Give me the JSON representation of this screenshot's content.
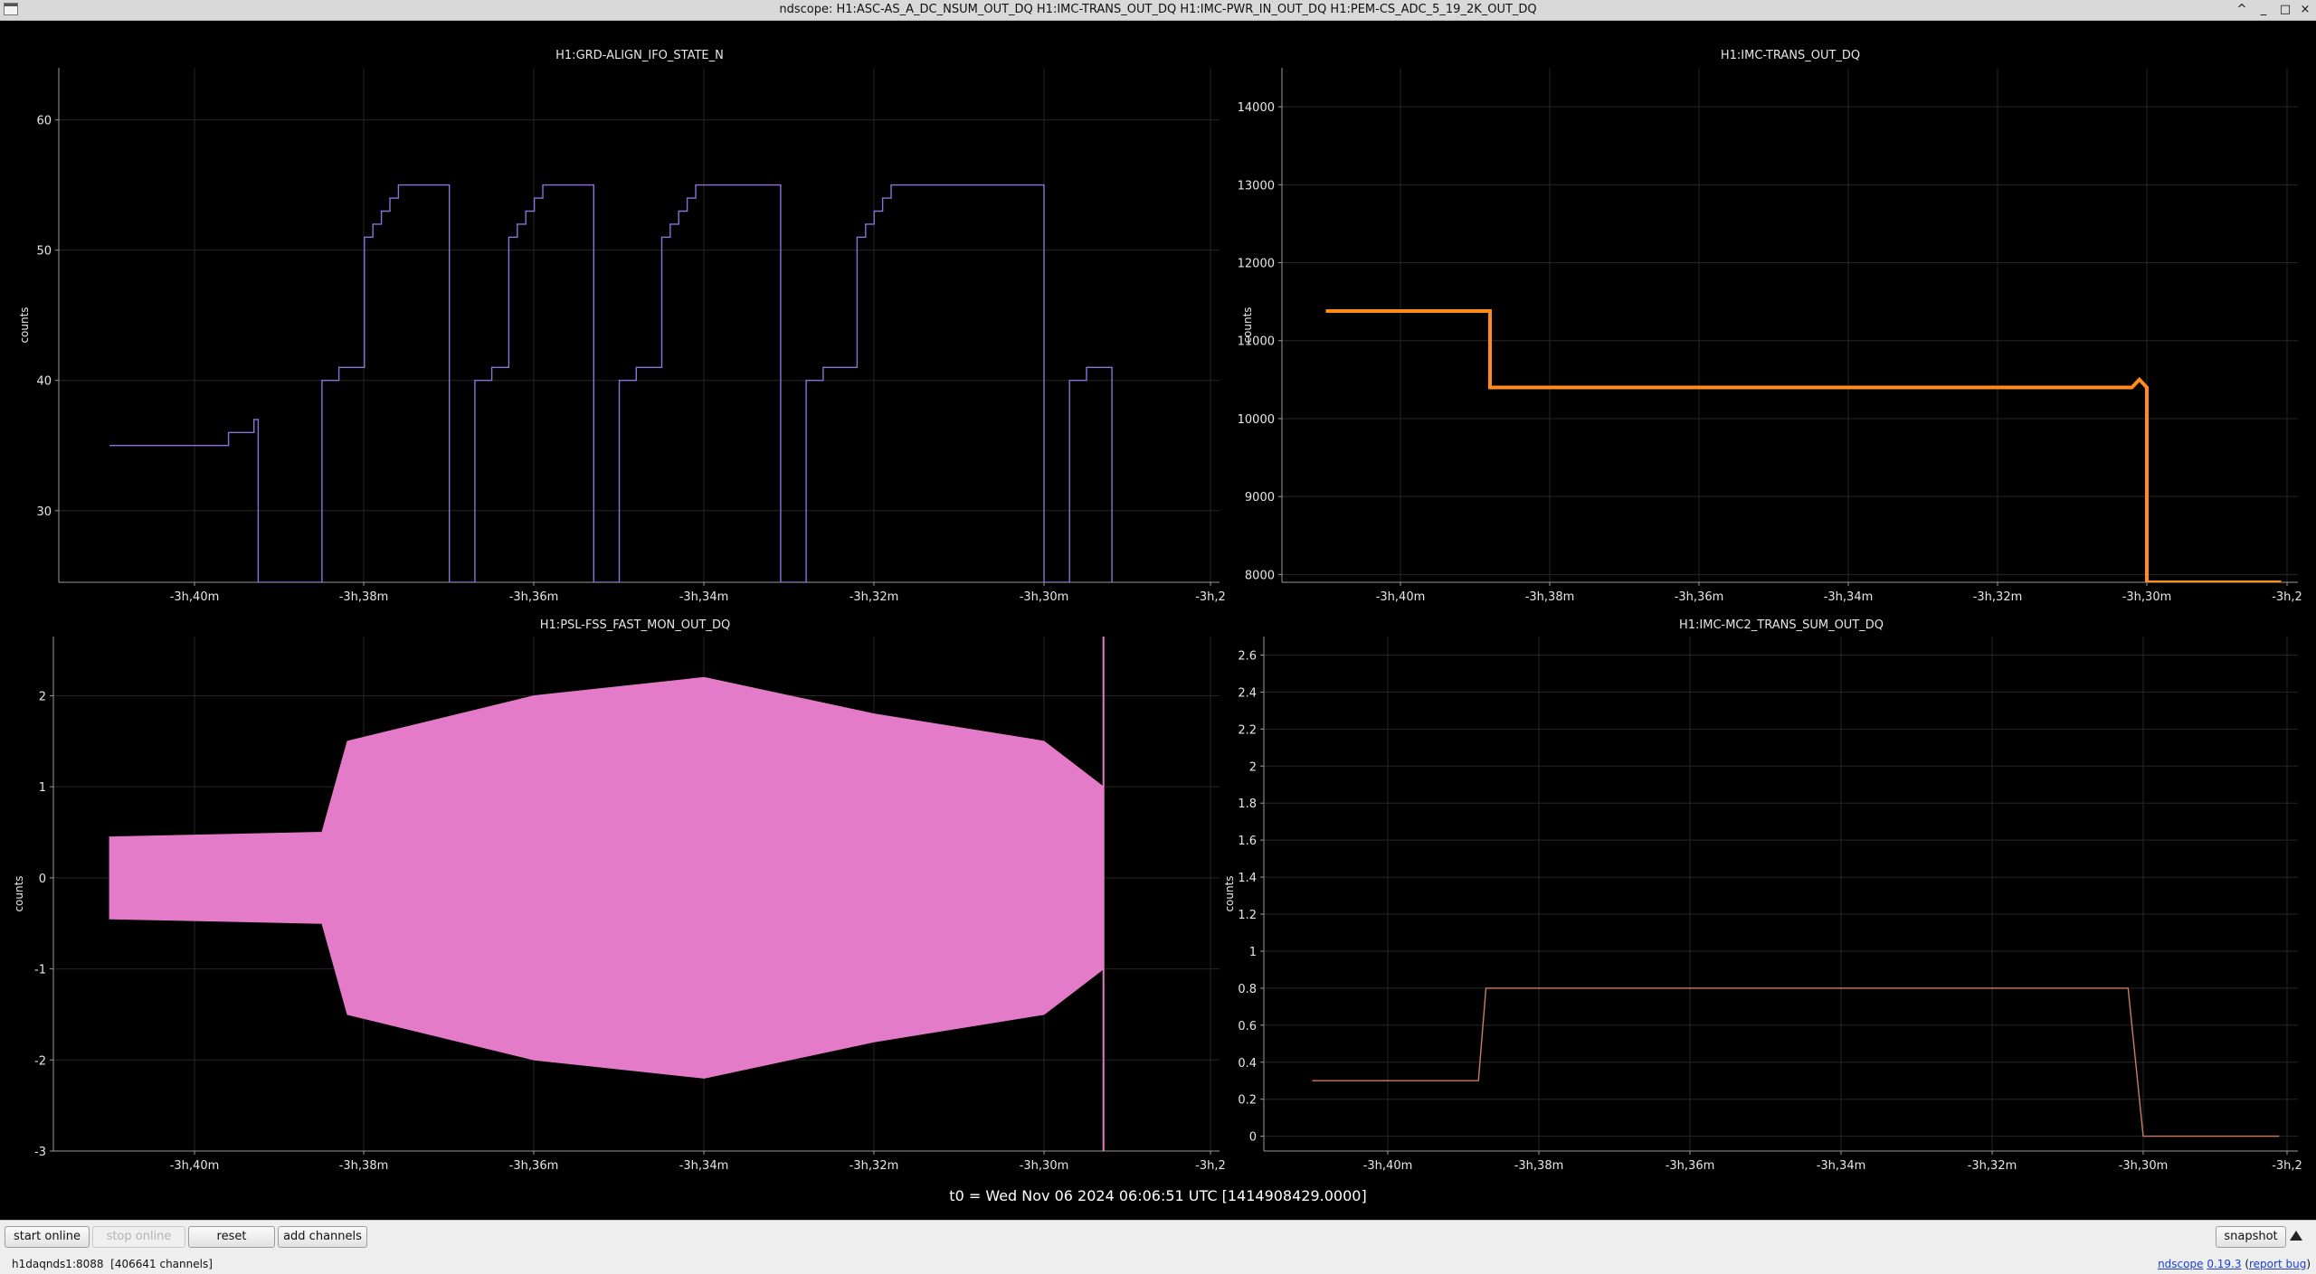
{
  "window": {
    "title": "ndscope: H1:ASC-AS_A_DC_NSUM_OUT_DQ H1:IMC-TRANS_OUT_DQ H1:IMC-PWR_IN_OUT_DQ H1:PEM-CS_ADC_5_19_2K_OUT_DQ",
    "controls": [
      "^",
      "_",
      "□",
      "×"
    ],
    "icons": [
      "chevron-up-icon",
      "minimize-icon",
      "maximize-icon",
      "close-icon"
    ]
  },
  "t0_label": "t0 = Wed Nov 06 2024 06:06:51 UTC [1414908429.0000]",
  "toolbar": {
    "start_online": "start online",
    "stop_online": "stop online",
    "reset": "reset",
    "add_channels": "add channels",
    "snapshot": "snapshot",
    "menu_icon": "triangle-up-icon"
  },
  "status": {
    "server": "h1daqnds1:8088",
    "channels": "[406641 channels]",
    "version_app": "ndscope",
    "version_num": "0.19.3",
    "report_bug": "report bug"
  },
  "chart_data": [
    {
      "type": "line",
      "title": "H1:GRD-ALIGN_IFO_STATE_N",
      "ylabel": "counts",
      "color": "#8a72d8",
      "grid": true,
      "x_unit": "time offset from t0",
      "xlim": [
        "-3h,41m",
        "-3h,28m"
      ],
      "x_ticks": [
        "-3h,40m",
        "-3h,38m",
        "-3h,36m",
        "-3h,34m",
        "-3h,32m",
        "-3h,30m",
        "-3h,2"
      ],
      "ylim": [
        24.5,
        64
      ],
      "y_ticks": [
        "30",
        "40",
        "50",
        "60"
      ],
      "y_tick_values": [
        30,
        40,
        50,
        60
      ],
      "series": [
        {
          "points": [
            [
              -41,
              35
            ],
            [
              -39.6,
              35
            ],
            [
              -39.6,
              36
            ],
            [
              -39.3,
              36
            ],
            [
              -39.3,
              37
            ],
            [
              -39.25,
              37
            ],
            [
              -39.25,
              24.5
            ],
            [
              -38.5,
              24.5
            ],
            [
              -38.5,
              40
            ],
            [
              -38.3,
              40
            ],
            [
              -38.3,
              41
            ],
            [
              -38,
              41
            ],
            [
              -38,
              51
            ],
            [
              -37.9,
              51
            ],
            [
              -37.9,
              52
            ],
            [
              -37.8,
              52
            ],
            [
              -37.8,
              53
            ],
            [
              -37.7,
              53
            ],
            [
              -37.7,
              54
            ],
            [
              -37.6,
              54
            ],
            [
              -37.6,
              55
            ],
            [
              -37.0,
              55
            ],
            [
              -37.0,
              24.5
            ],
            [
              -36.7,
              24.5
            ],
            [
              -36.7,
              40
            ],
            [
              -36.5,
              40
            ],
            [
              -36.5,
              41
            ],
            [
              -36.3,
              41
            ],
            [
              -36.3,
              51
            ],
            [
              -36.2,
              51
            ],
            [
              -36.2,
              52
            ],
            [
              -36.1,
              52
            ],
            [
              -36.1,
              53
            ],
            [
              -36.0,
              53
            ],
            [
              -36.0,
              54
            ],
            [
              -35.9,
              54
            ],
            [
              -35.9,
              55
            ],
            [
              -35.3,
              55
            ],
            [
              -35.3,
              24.5
            ],
            [
              -35.0,
              24.5
            ],
            [
              -35.0,
              40
            ],
            [
              -34.8,
              40
            ],
            [
              -34.8,
              41
            ],
            [
              -34.5,
              41
            ],
            [
              -34.5,
              51
            ],
            [
              -34.4,
              51
            ],
            [
              -34.4,
              52
            ],
            [
              -34.3,
              52
            ],
            [
              -34.3,
              53
            ],
            [
              -34.2,
              53
            ],
            [
              -34.2,
              54
            ],
            [
              -34.1,
              54
            ],
            [
              -34.1,
              55
            ],
            [
              -33.1,
              55
            ],
            [
              -33.1,
              24.5
            ],
            [
              -32.8,
              24.5
            ],
            [
              -32.8,
              40
            ],
            [
              -32.6,
              40
            ],
            [
              -32.6,
              41
            ],
            [
              -32.2,
              41
            ],
            [
              -32.2,
              51
            ],
            [
              -32.1,
              51
            ],
            [
              -32.1,
              52
            ],
            [
              -32.0,
              52
            ],
            [
              -32.0,
              53
            ],
            [
              -31.9,
              53
            ],
            [
              -31.9,
              54
            ],
            [
              -31.8,
              54
            ],
            [
              -31.8,
              55
            ],
            [
              -30.0,
              55
            ],
            [
              -30.0,
              24.5
            ],
            [
              -29.7,
              24.5
            ],
            [
              -29.7,
              40
            ],
            [
              -29.5,
              40
            ],
            [
              -29.5,
              41
            ],
            [
              -29.2,
              41
            ],
            [
              -29.2,
              24.5
            ]
          ]
        }
      ]
    },
    {
      "type": "line",
      "title": "H1:IMC-TRANS_OUT_DQ",
      "ylabel": "counts",
      "color": "#ff8c1a",
      "grid": true,
      "x_unit": "time offset from t0",
      "xlim": [
        "-3h,41m",
        "-3h,28m"
      ],
      "x_ticks": [
        "-3h,40m",
        "-3h,38m",
        "-3h,36m",
        "-3h,34m",
        "-3h,32m",
        "-3h,30m",
        "-3h,2"
      ],
      "ylim": [
        7900,
        14500
      ],
      "y_ticks": [
        "8000",
        "9000",
        "10000",
        "11000",
        "12000",
        "13000",
        "14000"
      ],
      "y_tick_values": [
        8000,
        9000,
        10000,
        11000,
        12000,
        13000,
        14000
      ],
      "series": [
        {
          "points": [
            [
              -41,
              11380
            ],
            [
              -38.8,
              11380
            ],
            [
              -38.8,
              10400
            ],
            [
              -30.2,
              10400
            ],
            [
              -30.1,
              10500
            ],
            [
              -30.0,
              10400
            ],
            [
              -30.0,
              7900
            ],
            [
              -28.2,
              7900
            ]
          ]
        }
      ]
    },
    {
      "type": "line",
      "title": "H1:PSL-FSS_FAST_MON_OUT_DQ",
      "ylabel": "counts",
      "color": "#e47bc8",
      "grid": true,
      "x_unit": "time offset from t0",
      "xlim": [
        "-3h,41m",
        "-3h,28m"
      ],
      "x_ticks": [
        "-3h,40m",
        "-3h,38m",
        "-3h,36m",
        "-3h,34m",
        "-3h,32m",
        "-3h,30m",
        "-3h,2"
      ],
      "ylim": [
        -3,
        2.65
      ],
      "y_ticks": [
        "-3",
        "-2",
        "-1",
        "0",
        "1",
        "2"
      ],
      "y_tick_values": [
        -3,
        -2,
        -1,
        0,
        1,
        2
      ],
      "series": [
        {
          "envelope": [
            {
              "x": -41,
              "max": 0.45,
              "min": -0.45
            },
            {
              "x": -38.5,
              "max": 0.5,
              "min": -0.5
            },
            {
              "x": -38.2,
              "max": 1.5,
              "min": -1.5
            },
            {
              "x": -36,
              "max": 2,
              "min": -2
            },
            {
              "x": -34,
              "max": 2.2,
              "min": -2.2
            },
            {
              "x": -32,
              "max": 1.8,
              "min": -1.8
            },
            {
              "x": -30,
              "max": 1.5,
              "min": -1.5
            },
            {
              "x": -29.3,
              "max": 1.0,
              "min": -1.0
            }
          ]
        }
      ]
    },
    {
      "type": "line",
      "title": "H1:IMC-MC2_TRANS_SUM_OUT_DQ",
      "ylabel": "counts",
      "color": "#c97e62",
      "grid": true,
      "x_unit": "time offset from t0",
      "xlim": [
        "-3h,41m",
        "-3h,28m"
      ],
      "x_ticks": [
        "-3h,40m",
        "-3h,38m",
        "-3h,36m",
        "-3h,34m",
        "-3h,32m",
        "-3h,30m",
        "-3h,2"
      ],
      "ylim": [
        -0.08,
        2.7
      ],
      "y_ticks": [
        "0",
        "0.2",
        "0.4",
        "0.6",
        "0.8",
        "1",
        "1.2",
        "1.4",
        "1.6",
        "1.8",
        "2",
        "2.2",
        "2.4",
        "2.6"
      ],
      "y_tick_values": [
        0,
        0.2,
        0.4,
        0.6,
        0.8,
        1.0,
        1.2,
        1.4,
        1.6,
        1.8,
        2.0,
        2.2,
        2.4,
        2.6
      ],
      "series": [
        {
          "points": [
            [
              -41,
              0.3
            ],
            [
              -38.8,
              0.3
            ],
            [
              -38.7,
              0.8
            ],
            [
              -30.2,
              0.8
            ],
            [
              -30.0,
              0.0
            ],
            [
              -28.2,
              0.0
            ]
          ]
        }
      ]
    }
  ]
}
